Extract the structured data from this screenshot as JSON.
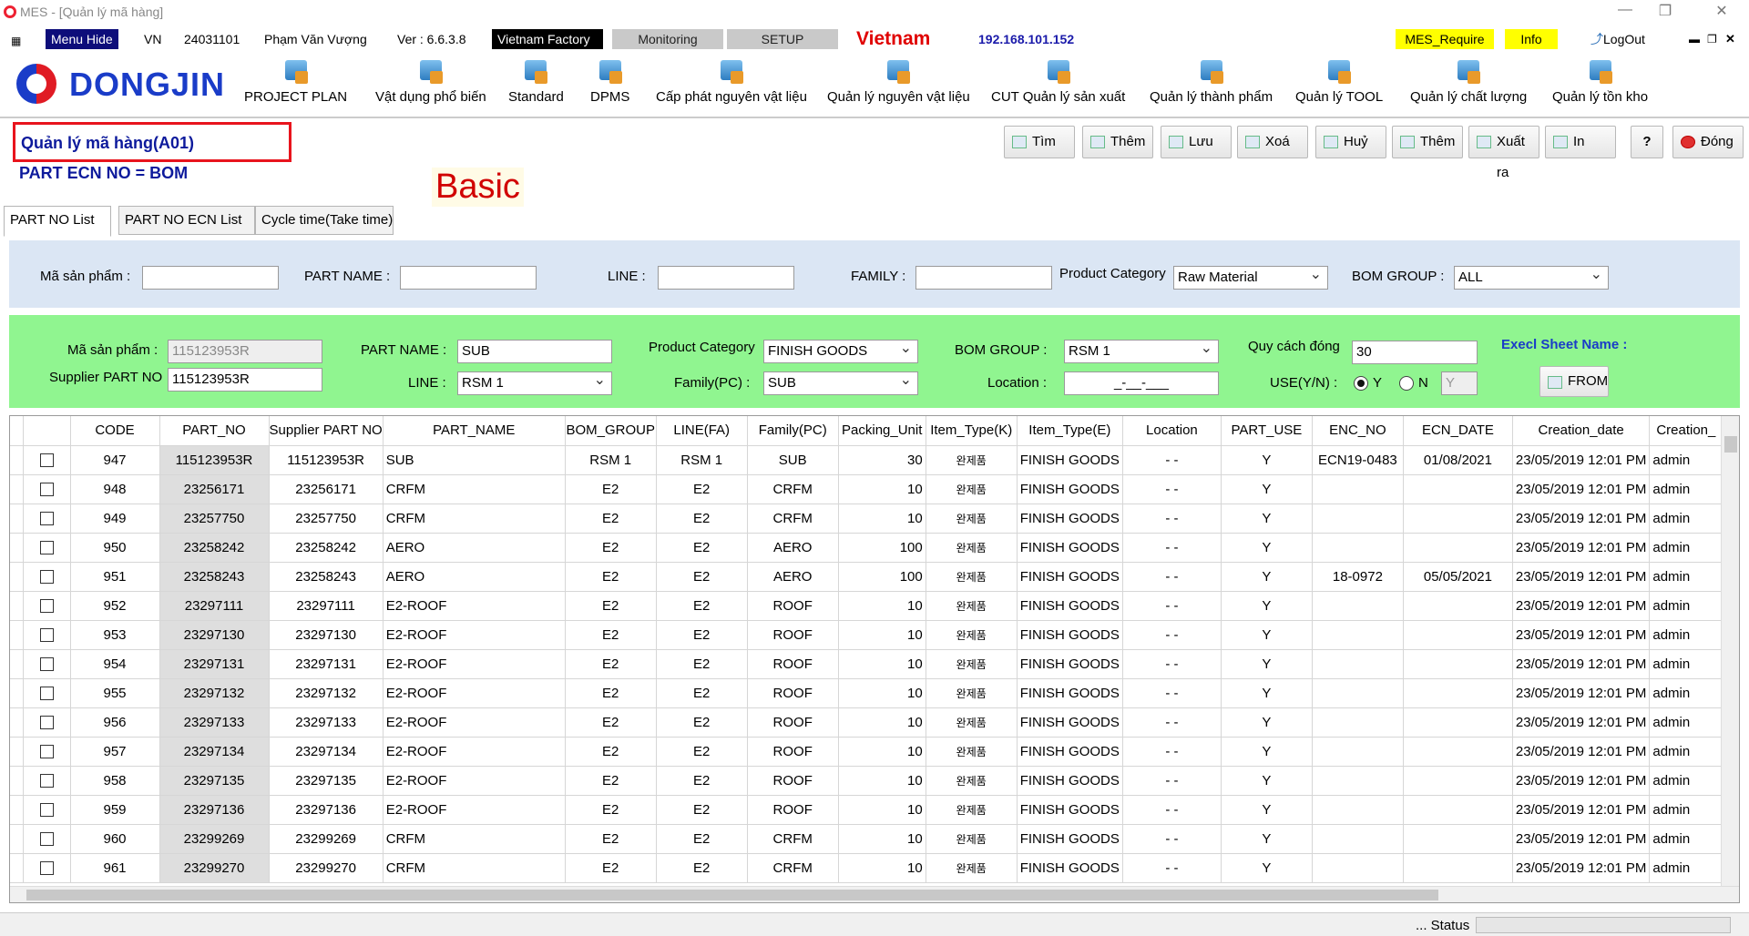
{
  "window": {
    "title": "MES - [Quản lý mã hàng]"
  },
  "menubar": {
    "menu_hide": "Menu Hide",
    "lang": "VN",
    "user_id": "24031101",
    "user_name": "Phạm Văn Vượng",
    "version": "Ver : 6.6.3.8",
    "factory": "Vietnam Factory",
    "monitoring": "Monitoring",
    "setup": "SETUP",
    "country": "Vietnam",
    "ip": "192.168.101.152",
    "mes_require": "MES_Require",
    "info": "Info",
    "logout": "LogOut"
  },
  "brand": {
    "name": "DONGJIN"
  },
  "toolbar": [
    {
      "label": "PROJECT PLAN",
      "icon": "people-icon"
    },
    {
      "label": "Vật dụng phổ biến",
      "icon": "boxes-icon"
    },
    {
      "label": "Standard",
      "icon": "fan-icon"
    },
    {
      "label": "DPMS",
      "icon": "folder-icon"
    },
    {
      "label": "Cấp phát nguyên vật liệu",
      "icon": "transfer-icon"
    },
    {
      "label": "Quản lý nguyên vật liệu",
      "icon": "material-add-icon"
    },
    {
      "label": "CUT Quản lý sản xuất",
      "icon": "production-icon"
    },
    {
      "label": "Quản lý thành phẩm",
      "icon": "product-icon"
    },
    {
      "label": "Quản lý TOOL",
      "icon": "tool-user-icon"
    },
    {
      "label": "Quản lý chất lượng",
      "icon": "quality-icon"
    },
    {
      "label": "Quản lý tồn kho",
      "icon": "inventory-icon"
    }
  ],
  "page": {
    "title": "Quản lý mã hàng(A01)",
    "subtitle": "PART ECN NO = BOM",
    "annotation": "Basic"
  },
  "actions": {
    "search": "Tìm",
    "add": "Thêm",
    "save": "Lưu",
    "delete": "Xoá",
    "cancel": "Huỷ",
    "add2": "Thêm",
    "export": "Xuất ra",
    "print": "In",
    "help": "?",
    "close": "Đóng"
  },
  "tabs": [
    "PART NO List",
    "PART NO ECN List",
    "Cycle time(Take time)"
  ],
  "filter": {
    "product_code_label": "Mã sản phẩm :",
    "product_code": "",
    "part_name_label": "PART NAME :",
    "part_name": "",
    "line_label": "LINE :",
    "line": "",
    "family_label": "FAMILY :",
    "family": "",
    "category_label": "Product Category",
    "category": "Raw Material",
    "bom_group_label": "BOM GROUP :",
    "bom_group": "ALL"
  },
  "editor": {
    "product_code_label": "Mã sản phẩm :",
    "product_code": "115123953R",
    "supplier_label": "Supplier PART NO",
    "supplier": "115123953R",
    "part_name_label": "PART NAME :",
    "part_name": "SUB",
    "line_label": "LINE :",
    "line": "RSM 1",
    "category_label": "Product Category",
    "category": "FINISH GOODS",
    "family_label": "Family(PC) :",
    "family": "SUB",
    "bom_group_label": "BOM GROUP :",
    "bom_group": "RSM 1",
    "location_label": "Location :",
    "location": "_-__-___",
    "packing_label": "Quy cách đóng",
    "packing": "30",
    "use_label": "USE(Y/N) :",
    "use_y": "Y",
    "use_n": "N",
    "use_value": "Y",
    "excel_label": "Execl Sheet Name :",
    "from_button": "FROM"
  },
  "grid": {
    "columns": [
      "",
      "CODE",
      "PART_NO",
      "Supplier PART NO",
      "PART_NAME",
      "BOM_GROUP",
      "LINE(FA)",
      "Family(PC)",
      "Packing_Unit",
      "Item_Type(K)",
      "Item_Type(E)",
      "Location",
      "PART_USE",
      "ENC_NO",
      "ECN_DATE",
      "Creation_date",
      "Creation_"
    ],
    "rows": [
      [
        "947",
        "115123953R",
        "115123953R",
        "SUB",
        "RSM 1",
        "RSM 1",
        "SUB",
        "30",
        "완제품",
        "FINISH GOODS",
        "- -",
        "Y",
        "ECN19-0483",
        "01/08/2021",
        "23/05/2019 12:01 PM",
        "admin"
      ],
      [
        "948",
        "23256171",
        "23256171",
        "CRFM",
        "E2",
        "E2",
        "CRFM",
        "10",
        "완제품",
        "FINISH GOODS",
        "- -",
        "Y",
        "",
        "",
        "23/05/2019 12:01 PM",
        "admin"
      ],
      [
        "949",
        "23257750",
        "23257750",
        "CRFM",
        "E2",
        "E2",
        "CRFM",
        "10",
        "완제품",
        "FINISH GOODS",
        "- -",
        "Y",
        "",
        "",
        "23/05/2019 12:01 PM",
        "admin"
      ],
      [
        "950",
        "23258242",
        "23258242",
        "AERO",
        "E2",
        "E2",
        "AERO",
        "100",
        "완제품",
        "FINISH GOODS",
        "- -",
        "Y",
        "",
        "",
        "23/05/2019 12:01 PM",
        "admin"
      ],
      [
        "951",
        "23258243",
        "23258243",
        "AERO",
        "E2",
        "E2",
        "AERO",
        "100",
        "완제품",
        "FINISH GOODS",
        "- -",
        "Y",
        "18-0972",
        "05/05/2021",
        "23/05/2019 12:01 PM",
        "admin"
      ],
      [
        "952",
        "23297111",
        "23297111",
        "E2-ROOF",
        "E2",
        "E2",
        "ROOF",
        "10",
        "완제품",
        "FINISH GOODS",
        "- -",
        "Y",
        "",
        "",
        "23/05/2019 12:01 PM",
        "admin"
      ],
      [
        "953",
        "23297130",
        "23297130",
        "E2-ROOF",
        "E2",
        "E2",
        "ROOF",
        "10",
        "완제품",
        "FINISH GOODS",
        "- -",
        "Y",
        "",
        "",
        "23/05/2019 12:01 PM",
        "admin"
      ],
      [
        "954",
        "23297131",
        "23297131",
        "E2-ROOF",
        "E2",
        "E2",
        "ROOF",
        "10",
        "완제품",
        "FINISH GOODS",
        "- -",
        "Y",
        "",
        "",
        "23/05/2019 12:01 PM",
        "admin"
      ],
      [
        "955",
        "23297132",
        "23297132",
        "E2-ROOF",
        "E2",
        "E2",
        "ROOF",
        "10",
        "완제품",
        "FINISH GOODS",
        "- -",
        "Y",
        "",
        "",
        "23/05/2019 12:01 PM",
        "admin"
      ],
      [
        "956",
        "23297133",
        "23297133",
        "E2-ROOF",
        "E2",
        "E2",
        "ROOF",
        "10",
        "완제품",
        "FINISH GOODS",
        "- -",
        "Y",
        "",
        "",
        "23/05/2019 12:01 PM",
        "admin"
      ],
      [
        "957",
        "23297134",
        "23297134",
        "E2-ROOF",
        "E2",
        "E2",
        "ROOF",
        "10",
        "완제품",
        "FINISH GOODS",
        "- -",
        "Y",
        "",
        "",
        "23/05/2019 12:01 PM",
        "admin"
      ],
      [
        "958",
        "23297135",
        "23297135",
        "E2-ROOF",
        "E2",
        "E2",
        "ROOF",
        "10",
        "완제품",
        "FINISH GOODS",
        "- -",
        "Y",
        "",
        "",
        "23/05/2019 12:01 PM",
        "admin"
      ],
      [
        "959",
        "23297136",
        "23297136",
        "E2-ROOF",
        "E2",
        "E2",
        "ROOF",
        "10",
        "완제품",
        "FINISH GOODS",
        "- -",
        "Y",
        "",
        "",
        "23/05/2019 12:01 PM",
        "admin"
      ],
      [
        "960",
        "23299269",
        "23299269",
        "CRFM",
        "E2",
        "E2",
        "CRFM",
        "10",
        "완제품",
        "FINISH GOODS",
        "- -",
        "Y",
        "",
        "",
        "23/05/2019 12:01 PM",
        "admin"
      ],
      [
        "961",
        "23299270",
        "23299270",
        "CRFM",
        "E2",
        "E2",
        "CRFM",
        "10",
        "완제품",
        "FINISH GOODS",
        "- -",
        "Y",
        "",
        "",
        "23/05/2019 12:01 PM",
        "admin"
      ]
    ]
  },
  "status": {
    "label": "... Status"
  },
  "colors": {
    "accent_red": "#e8141d",
    "title_blue": "#0d1a9c",
    "filter_bg": "#dbe6f4",
    "editor_bg": "#90f590",
    "require_yellow": "#ffff00"
  }
}
